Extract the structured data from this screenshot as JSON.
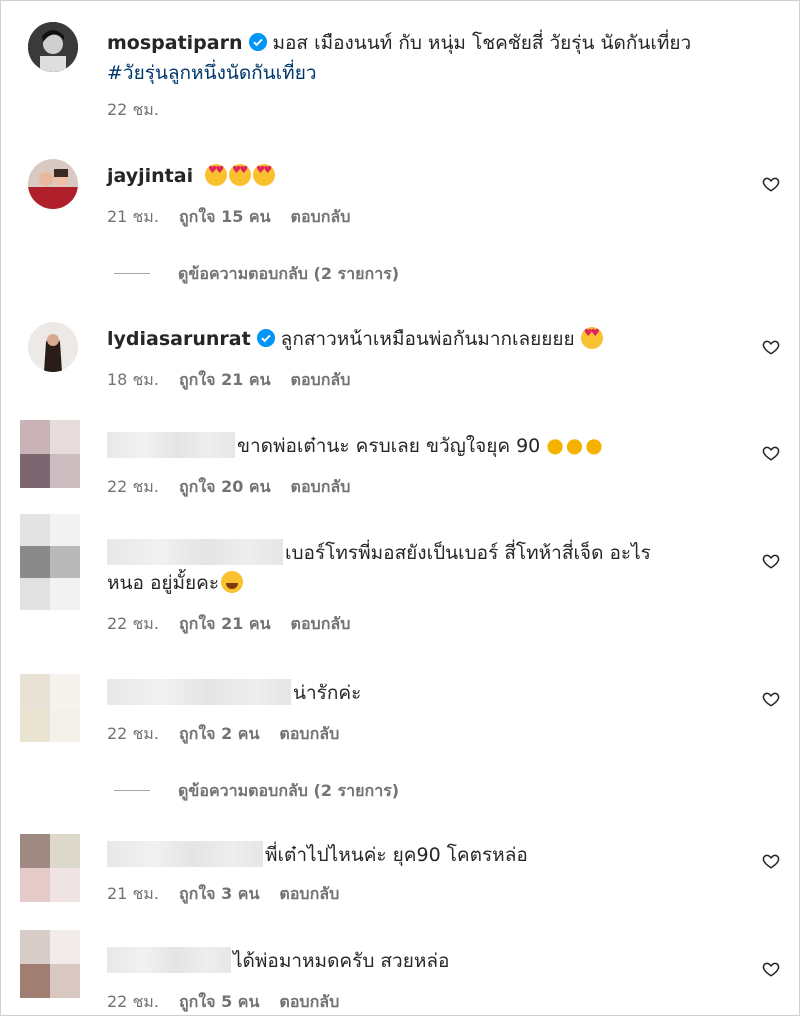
{
  "post": {
    "username": "mospatiparn",
    "caption": "มอส เมืองนนท์ กับ หนุ่ม โชคชัยสี่ วัยรุ่น นัดกันเที่ยว",
    "hashtag": "#วัยรุ่นลูกหนึ่งนัดกันเที่ยว",
    "time": "22 ชม."
  },
  "comments": [
    {
      "username": "jayjintai",
      "text": "",
      "emojis": "love-eyes x3",
      "time": "21 ชม.",
      "likes": "ถูกใจ 15 คน",
      "reply": "ตอบกลับ"
    },
    {
      "username": "lydiasarunrat",
      "text": "ลูกสาวหน้าเหมือนพ่อกันมากเลยยยย",
      "time": "18 ชม.",
      "likes": "ถูกใจ 21 คน",
      "reply": "ตอบกลับ"
    },
    {
      "username": "",
      "text": "ขาดพ่อเต๋านะ ครบเลย ขวัญใจยุค 90",
      "time": "22 ชม.",
      "likes": "ถูกใจ 20 คน",
      "reply": "ตอบกลับ"
    },
    {
      "username": "",
      "text": "เบอร์โทรพี่มอสยังเป็นเบอร์ สี่โทห้าสี่เจ็ด อะไร",
      "text2": "หนอ อยู่มั้ยคะ",
      "time": "22 ชม.",
      "likes": "ถูกใจ 21 คน",
      "reply": "ตอบกลับ"
    },
    {
      "username": "",
      "text": "น่ารักค่ะ",
      "time": "22 ชม.",
      "likes": "ถูกใจ 2 คน",
      "reply": "ตอบกลับ"
    },
    {
      "username": "",
      "text": "พี่เต๋าไปไหนค่ะ ยุค90 โคตรหล่อ",
      "time": "21 ชม.",
      "likes": "ถูกใจ 3 คน",
      "reply": "ตอบกลับ"
    },
    {
      "username": "",
      "text": "ได้พ่อมาหมดครับ สวยหล่อ",
      "time": "22 ชม.",
      "likes": "ถูกใจ 5 คน",
      "reply": "ตอบกลับ"
    }
  ],
  "view_replies": [
    "ดูข้อความตอบกลับ (2 รายการ)",
    "ดูข้อความตอบกลับ (2 รายการ)"
  ],
  "icons": {
    "verified": "verified-badge-icon",
    "like": "heart-outline-icon"
  },
  "colors": {
    "verified": "#0095f6",
    "link": "#00376b",
    "secondary": "#737373"
  }
}
